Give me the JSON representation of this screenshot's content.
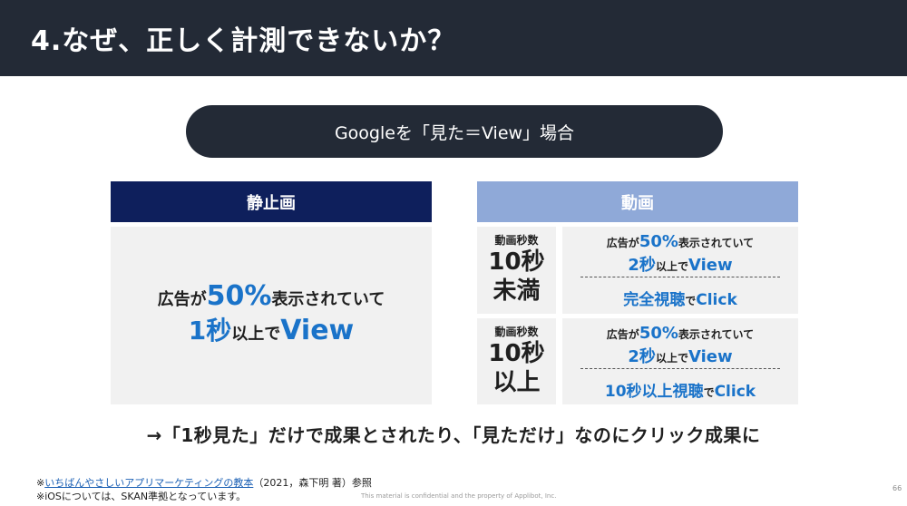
{
  "header": {
    "title": "4.なぜ、正しく計測できないか？"
  },
  "pill": {
    "text": "Googleを「見た＝View」場合"
  },
  "columns": {
    "static_title": "静止画",
    "video_title": "動画"
  },
  "static": {
    "pre": "広告が",
    "percent": "50%",
    "post": "表示されていて",
    "sec": "1秒",
    "ijo": "以上で",
    "view": "View"
  },
  "video": {
    "rows": [
      {
        "dur_label": "動画秒数",
        "dur_l1": "10秒",
        "dur_l2": "未満",
        "pre": "広告が",
        "percent": "50%",
        "post": "表示されていて",
        "sec": "2秒",
        "ijo": "以上で",
        "view": "View",
        "bottom_main": "完全視聴",
        "bottom_de": "で",
        "bottom_click": "Click"
      },
      {
        "dur_label": "動画秒数",
        "dur_l1": "10秒",
        "dur_l2": "以上",
        "pre": "広告が",
        "percent": "50%",
        "post": "表示されていて",
        "sec": "2秒",
        "ijo": "以上で",
        "view": "View",
        "bottom_main": "10秒以上視聴",
        "bottom_de": "で",
        "bottom_click": "Click"
      }
    ]
  },
  "conclusion": "→「1秒見た」だけで成果とされたり、「見ただけ」なのにクリック成果に",
  "footnotes": {
    "f1_mark": "※",
    "f1_link": "いちばんやさしいアプリマーケティングの教本",
    "f1_rest": "（2021，森下明 著）参照",
    "f2": "※iOSについては、SKAN準拠となっています。"
  },
  "confidential": "This material is confidential and the property of Applibot, Inc.",
  "page_number": "66",
  "colors": {
    "header_bg": "#232a36",
    "static_head": "#0e1f5c",
    "video_head": "#8fa9d8",
    "accent_blue": "#1a73c9",
    "box_bg": "#f1f1f1"
  }
}
